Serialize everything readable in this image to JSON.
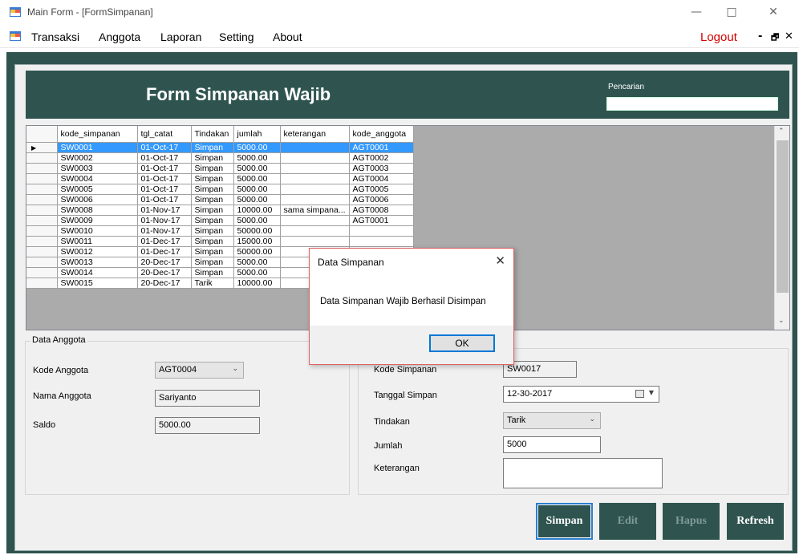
{
  "window": {
    "title": "Main Form - [FormSimpanan]",
    "minimize": "—",
    "maximize": "□",
    "close": "✕"
  },
  "menu": {
    "items": [
      "Transaksi",
      "Anggota",
      "Laporan",
      "Setting",
      "About"
    ],
    "logout": "Logout",
    "mdi_minimize": "-",
    "mdi_restore": "🗗",
    "mdi_close": "✕"
  },
  "header": {
    "title": "Form Simpanan Wajib",
    "search_label": "Pencarian",
    "search_value": ""
  },
  "grid": {
    "columns": [
      "kode_simpanan",
      "tgl_catat",
      "Tindakan",
      "jumlah",
      "keterangan",
      "kode_anggota"
    ],
    "rows": [
      [
        "SW0001",
        "01-Oct-17",
        "Simpan",
        "5000.00",
        "",
        "AGT0001"
      ],
      [
        "SW0002",
        "01-Oct-17",
        "Simpan",
        "5000.00",
        "",
        "AGT0002"
      ],
      [
        "SW0003",
        "01-Oct-17",
        "Simpan",
        "5000.00",
        "",
        "AGT0003"
      ],
      [
        "SW0004",
        "01-Oct-17",
        "Simpan",
        "5000.00",
        "",
        "AGT0004"
      ],
      [
        "SW0005",
        "01-Oct-17",
        "Simpan",
        "5000.00",
        "",
        "AGT0005"
      ],
      [
        "SW0006",
        "01-Oct-17",
        "Simpan",
        "5000.00",
        "",
        "AGT0006"
      ],
      [
        "SW0008",
        "01-Nov-17",
        "Simpan",
        "10000.00",
        "sama simpana...",
        "AGT0008"
      ],
      [
        "SW0009",
        "01-Nov-17",
        "Simpan",
        "5000.00",
        "",
        "AGT0001"
      ],
      [
        "SW0010",
        "01-Nov-17",
        "Simpan",
        "50000.00",
        "",
        ""
      ],
      [
        "SW0011",
        "01-Dec-17",
        "Simpan",
        "15000.00",
        "",
        ""
      ],
      [
        "SW0012",
        "01-Dec-17",
        "Simpan",
        "50000.00",
        "",
        ""
      ],
      [
        "SW0013",
        "20-Dec-17",
        "Simpan",
        "5000.00",
        "",
        ""
      ],
      [
        "SW0014",
        "20-Dec-17",
        "Simpan",
        "5000.00",
        "",
        ""
      ],
      [
        "SW0015",
        "20-Dec-17",
        "Tarik",
        "10000.00",
        "",
        ""
      ]
    ],
    "selected_row": 0,
    "row_pointer": "▶"
  },
  "anggota": {
    "legend": "Data Anggota",
    "kode_label": "Kode Anggota",
    "kode_value": "AGT0004",
    "nama_label": "Nama Anggota",
    "nama_value": "Sariyanto",
    "saldo_label": "Saldo",
    "saldo_value": "5000.00"
  },
  "simpanan": {
    "kode_label": "Kode Simpanan",
    "kode_value": "SW0017",
    "tanggal_label": "Tanggal Simpan",
    "tanggal_value": "12-30-2017",
    "tindakan_label": "Tindakan",
    "tindakan_value": "Tarik",
    "jumlah_label": "Jumlah",
    "jumlah_value": "5000",
    "keterangan_label": "Keterangan",
    "keterangan_value": ""
  },
  "buttons": {
    "simpan": "Simpan",
    "edit": "Edit",
    "hapus": "Hapus",
    "refresh": "Refresh"
  },
  "dialog": {
    "title": "Data Simpanan",
    "message": "Data Simpanan Wajib Berhasil Disimpan",
    "ok": "OK",
    "close": "✕"
  },
  "colors": {
    "theme": "#2f5450",
    "selection": "#3399ff",
    "logout": "#d40000"
  }
}
